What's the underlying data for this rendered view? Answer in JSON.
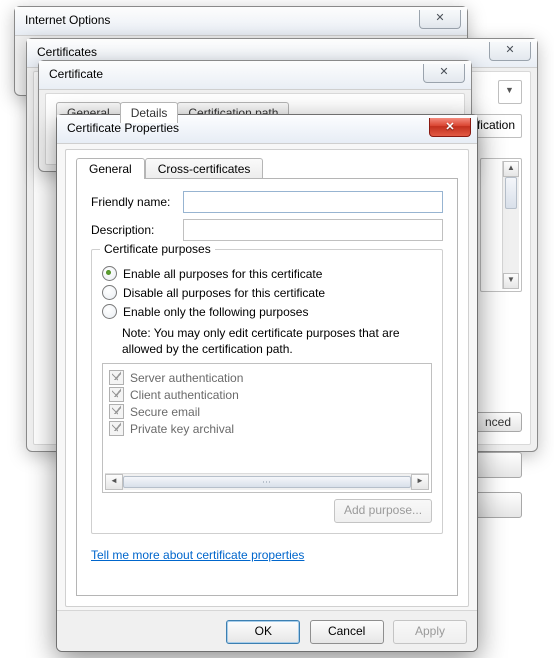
{
  "bg_windows": {
    "internet_options_title": "Internet Options",
    "certificates_title": "Certificates",
    "certificate_title": "Certificate",
    "certificate_tabs": {
      "general": "General",
      "details": "Details",
      "certpath": "Certification path"
    },
    "right_hints": {
      "fication_tab_frag": "fication",
      "advanced_btn_frag": "nced"
    }
  },
  "dialog": {
    "title": "Certificate Properties",
    "tabs": {
      "general": "General",
      "cross": "Cross-certificates"
    },
    "fields": {
      "friendly_label": "Friendly name:",
      "friendly_value": "",
      "description_label": "Description:",
      "description_value": ""
    },
    "group": {
      "legend": "Certificate purposes",
      "opt_enable_all": "Enable all purposes for this certificate",
      "opt_disable_all": "Disable all purposes for this certificate",
      "opt_enable_only": "Enable only the following purposes",
      "selected": "enable_all",
      "note": "Note: You may only edit certificate purposes that are allowed by the certification path.",
      "purposes": [
        "Server authentication",
        "Client authentication",
        "Secure email",
        "Private key archival"
      ],
      "add_purpose": "Add purpose..."
    },
    "help_link": "Tell me more about certificate properties",
    "buttons": {
      "ok": "OK",
      "cancel": "Cancel",
      "apply": "Apply"
    }
  },
  "glyphs": {
    "x": "✕",
    "up": "▲",
    "down": "▼",
    "left": "◄",
    "right": "►"
  }
}
